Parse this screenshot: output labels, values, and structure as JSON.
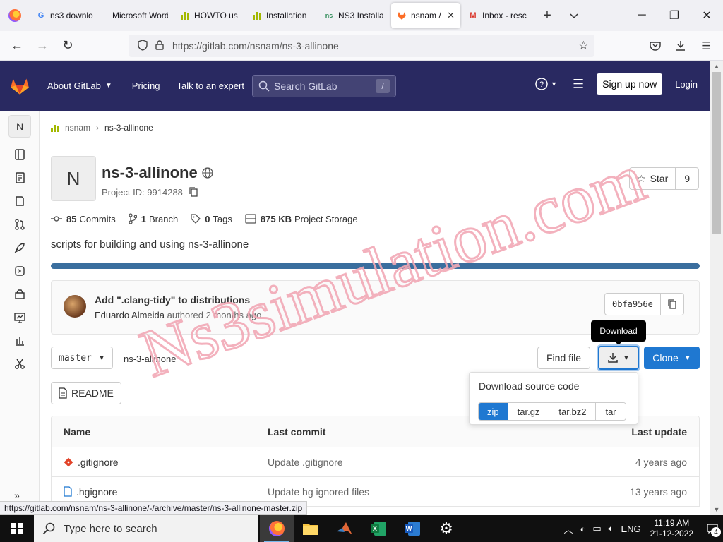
{
  "browser": {
    "tabs": [
      {
        "label": "ns3 downlo",
        "icon": "google-icon"
      },
      {
        "label": "Microsoft Word",
        "icon": "none"
      },
      {
        "label": "HOWTO us",
        "icon": "nsnam-wiki-icon"
      },
      {
        "label": "Installation",
        "icon": "nsnam-wiki-icon"
      },
      {
        "label": "NS3 Installa",
        "icon": "ns3-icon"
      },
      {
        "label": "nsnam /",
        "icon": "gitlab-icon",
        "active": true
      },
      {
        "label": "Inbox - resc",
        "icon": "gmail-icon"
      }
    ],
    "url_host": "https://gitlab.com",
    "url_path": "/nsnam/ns-3-allinone",
    "status_url": "https://gitlab.com/nsnam/ns-3-allinone/-/archive/master/ns-3-allinone-master.zip"
  },
  "gitlab_header": {
    "about": "About GitLab",
    "pricing": "Pricing",
    "talk": "Talk to an expert",
    "search_placeholder": "Search GitLab",
    "search_shortcut": "/",
    "signup": "Sign up now",
    "login": "Login"
  },
  "sidebar": {
    "avatar_letter": "N",
    "icons": [
      "project-info-icon",
      "repository-icon",
      "issues-icon",
      "merge-requests-icon",
      "ci-cd-icon",
      "deployments-icon",
      "packages-icon",
      "monitor-icon",
      "analytics-icon",
      "snippets-icon"
    ]
  },
  "breadcrumb": {
    "group": "nsnam",
    "project": "ns-3-allinone"
  },
  "project": {
    "avatar_letter": "N",
    "name": "ns-3-allinone",
    "id_text": "Project ID: 9914288",
    "star_label": "Star",
    "star_count": "9",
    "stats": {
      "commits_count": "85",
      "commits_label": "Commits",
      "branch_count": "1",
      "branch_label": "Branch",
      "tags_count": "0",
      "tags_label": "Tags",
      "storage_size": "875 KB",
      "storage_label": "Project Storage"
    },
    "description": "scripts for building and using ns-3-allinone"
  },
  "last_commit": {
    "title": "Add \".clang-tidy\" to distributions",
    "author": "Eduardo Almeida",
    "meta": "authored 2 months ago",
    "sha": "0bfa956e"
  },
  "repo_toolbar": {
    "branch": "master",
    "path": "ns-3-allinone",
    "find_file": "Find file",
    "download_tooltip": "Download",
    "clone": "Clone"
  },
  "download_panel": {
    "heading": "Download source code",
    "formats": [
      "zip",
      "tar.gz",
      "tar.bz2",
      "tar"
    ],
    "selected": "zip"
  },
  "readme_label": "README",
  "file_table": {
    "headers": {
      "name": "Name",
      "last_commit": "Last commit",
      "last_update": "Last update"
    },
    "rows": [
      {
        "name": ".gitignore",
        "icon": "git-icon",
        "commit": "Update .gitignore",
        "updated": "4 years ago"
      },
      {
        "name": ".hgignore",
        "icon": "file-icon",
        "commit": "Update hg ignored files",
        "updated": "13 years ago"
      }
    ]
  },
  "watermark": "Ns3simulation.com",
  "taskbar": {
    "search_placeholder": "Type here to search",
    "language": "ENG",
    "time": "11:19 AM",
    "date": "21-12-2022",
    "notifications": "4"
  },
  "colors": {
    "gitlab_header": "#292961",
    "primary_blue": "#1f78d1",
    "watermark": "#f2a9b6",
    "progress_bar": "#3a6e9e"
  }
}
